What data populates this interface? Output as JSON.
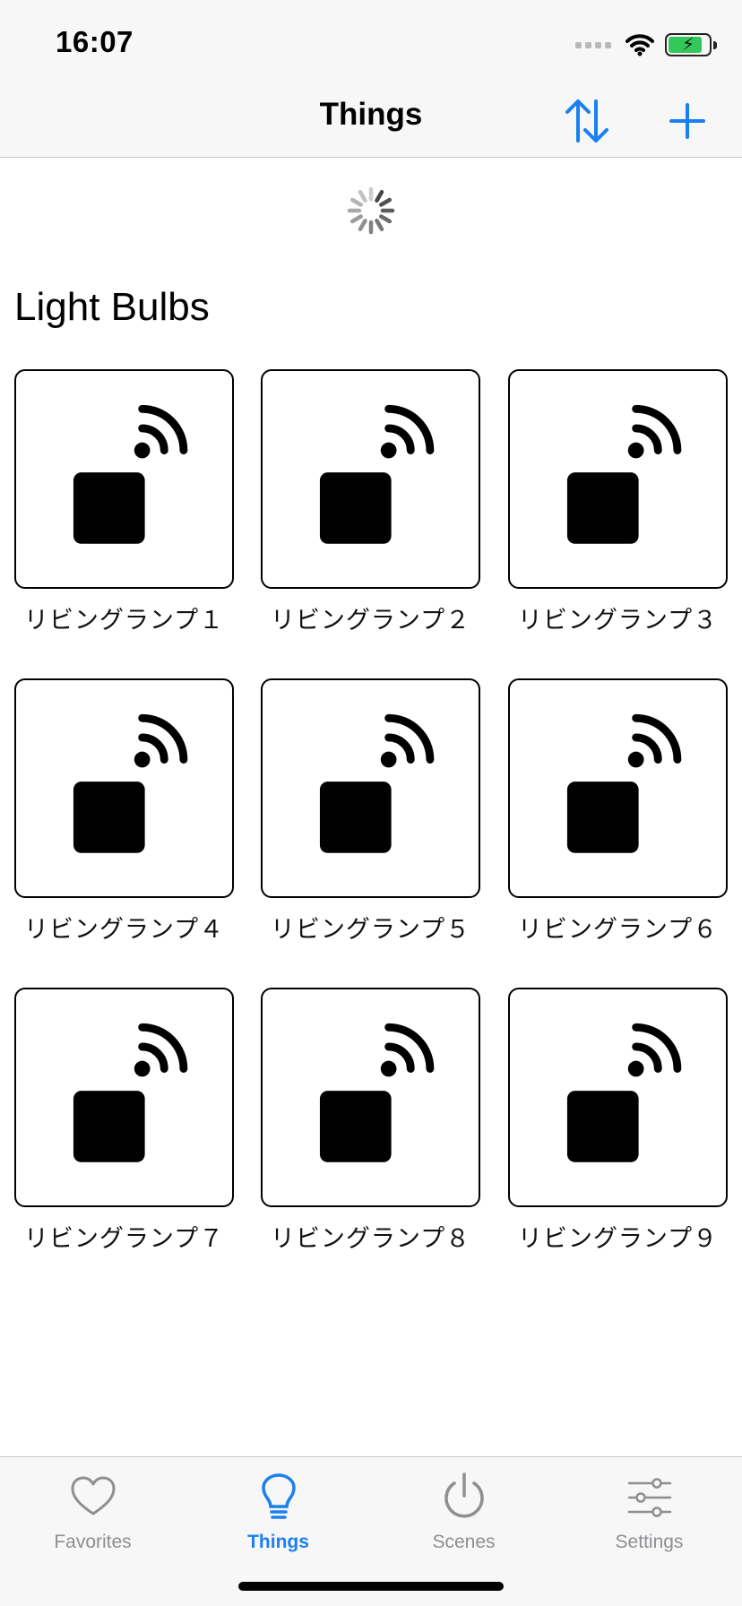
{
  "status_bar": {
    "time": "16:07",
    "icons": [
      "cellular-signal-icon",
      "wifi-icon",
      "battery-charging-icon"
    ],
    "battery_percent": 85
  },
  "nav": {
    "title": "Things",
    "sort_icon": "sort-arrows-icon",
    "add_icon": "plus-icon",
    "accent_color": "#1a7ff0"
  },
  "loading": {
    "icon": "activity-spinner-icon"
  },
  "section": {
    "title": "Light Bulbs"
  },
  "devices": [
    {
      "label": "リビングランプ１",
      "icon": "smart-plug-wifi-icon"
    },
    {
      "label": "リビングランプ２",
      "icon": "smart-plug-wifi-icon"
    },
    {
      "label": "リビングランプ３",
      "icon": "smart-plug-wifi-icon"
    },
    {
      "label": "リビングランプ４",
      "icon": "smart-plug-wifi-icon"
    },
    {
      "label": "リビングランプ５",
      "icon": "smart-plug-wifi-icon"
    },
    {
      "label": "リビングランプ６",
      "icon": "smart-plug-wifi-icon"
    },
    {
      "label": "リビングランプ７",
      "icon": "smart-plug-wifi-icon"
    },
    {
      "label": "リビングランプ８",
      "icon": "smart-plug-wifi-icon"
    },
    {
      "label": "リビングランプ９",
      "icon": "smart-plug-wifi-icon"
    }
  ],
  "tabs": [
    {
      "label": "Favorites",
      "icon": "heart-icon",
      "active": false
    },
    {
      "label": "Things",
      "icon": "lightbulb-icon",
      "active": true
    },
    {
      "label": "Scenes",
      "icon": "power-icon",
      "active": false
    },
    {
      "label": "Settings",
      "icon": "sliders-icon",
      "active": false
    }
  ]
}
